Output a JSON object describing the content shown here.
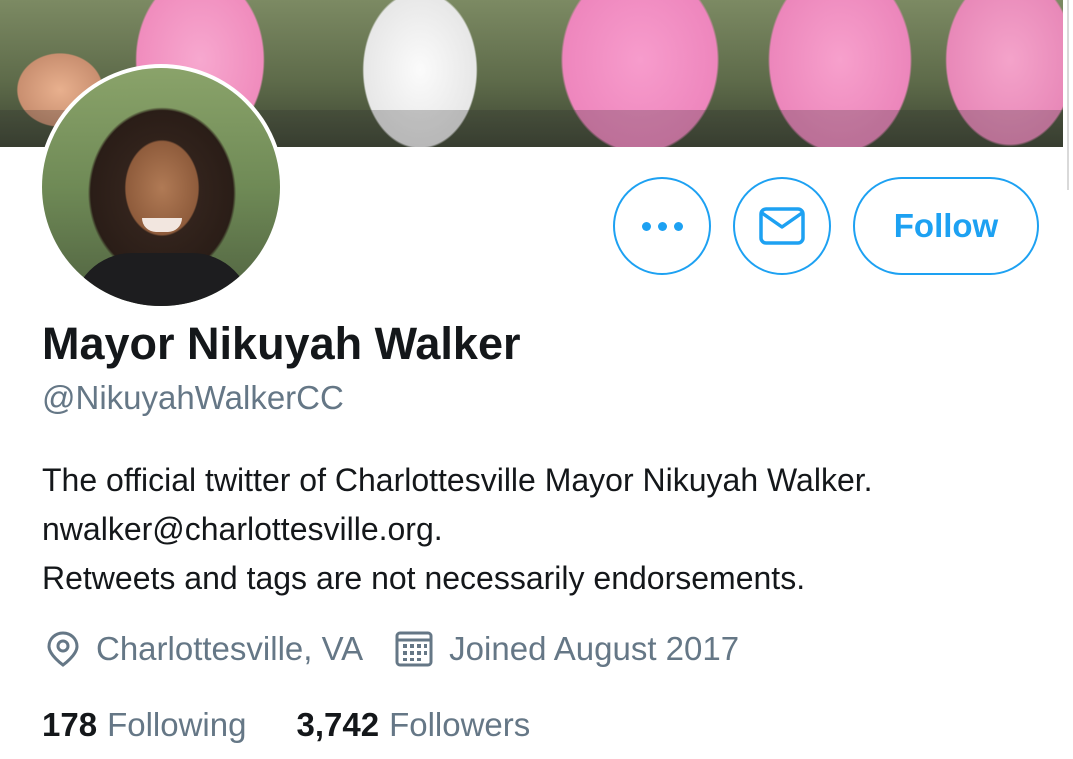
{
  "profile": {
    "name": "Mayor Nikuyah Walker",
    "handle": "@NikuyahWalkerCC",
    "bio_lines": [
      "The official twitter of Charlottesville Mayor Nikuyah Walker.",
      "nwalker@charlottesville.org.",
      "Retweets and tags are not necessarily endorsements."
    ],
    "location": "Charlottesville, VA",
    "joined": "Joined August 2017"
  },
  "stats": {
    "following_count": "178",
    "following_label": "Following",
    "followers_count": "3,742",
    "followers_label": "Followers"
  },
  "actions": {
    "follow_label": "Follow"
  },
  "icons": {
    "more": "more-dots-icon",
    "mail": "envelope-icon",
    "location": "location-pin-icon",
    "calendar": "calendar-icon"
  },
  "colors": {
    "accent": "#1da1f2",
    "text": "#14171a",
    "muted": "#657786"
  }
}
